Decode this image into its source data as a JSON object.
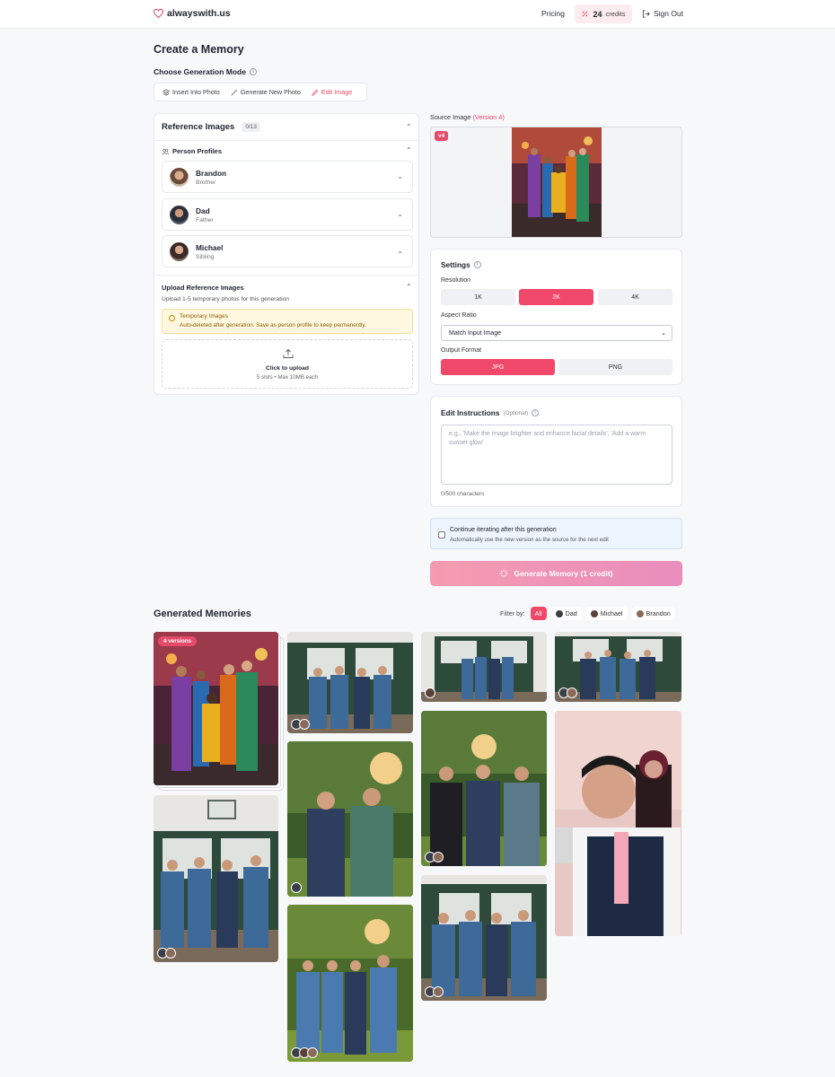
{
  "brand": {
    "name": "alwayswith.us"
  },
  "nav": {
    "pricing": "Pricing",
    "credits_num": "24",
    "credits_label": "credits",
    "signout": "Sign Out"
  },
  "page": {
    "title": "Create a Memory"
  },
  "mode": {
    "label": "Choose Generation Mode",
    "tabs": [
      {
        "label": "Insert Into Photo",
        "icon": "layers-icon"
      },
      {
        "label": "Generate New Photo",
        "icon": "magic-wand-icon"
      },
      {
        "label": "Edit Image",
        "icon": "pencil-icon",
        "active": true
      }
    ]
  },
  "reference": {
    "title": "Reference Images",
    "count": "0/13",
    "profiles_label": "Person Profiles",
    "people": [
      {
        "name": "Brandon",
        "role": "Brother"
      },
      {
        "name": "Dad",
        "role": "Father"
      },
      {
        "name": "Michael",
        "role": "Sibling"
      }
    ],
    "upload_title": "Upload Reference Images",
    "upload_sub": "Upload 1-5 temporary photos for this generation",
    "temp_title": "Temporary Images",
    "temp_text": "Auto-deleted after generation. Save as person profile to keep permanently.",
    "drop_title": "Click to upload",
    "drop_sub": "5 slots • Max 10MB each"
  },
  "source": {
    "label": "Source Image",
    "version": "(Version 4)",
    "badge": "v4"
  },
  "settings": {
    "title": "Settings",
    "resolution_label": "Resolution",
    "resolutions": [
      "1K",
      "2K",
      "4K"
    ],
    "resolution_selected": "2K",
    "aspect_label": "Aspect Ratio",
    "aspect_value": "Match Input Image",
    "format_label": "Output Format",
    "formats": [
      "JPG",
      "PNG"
    ],
    "format_selected": "JPG"
  },
  "edit": {
    "title": "Edit Instructions",
    "optional": "(Optional)",
    "placeholder": "e.g., 'Make the image brighter and enhance facial details', 'Add a warm sunset glow'",
    "chars": "0/500 characters"
  },
  "iterate": {
    "title": "Continue iterating after this generation",
    "sub": "Automatically use the new version as the source for the next edit"
  },
  "generate": {
    "label": "Generate Memory (1 credit)"
  },
  "gallery": {
    "title": "Generated Memories",
    "filter_label": "Filter by:",
    "filters": [
      "All",
      "Dad",
      "Michael",
      "Brandon"
    ],
    "versions_badge": "4 versions"
  },
  "colors": {
    "accent": "#f0486a",
    "accent_text": "#e64a6a"
  }
}
